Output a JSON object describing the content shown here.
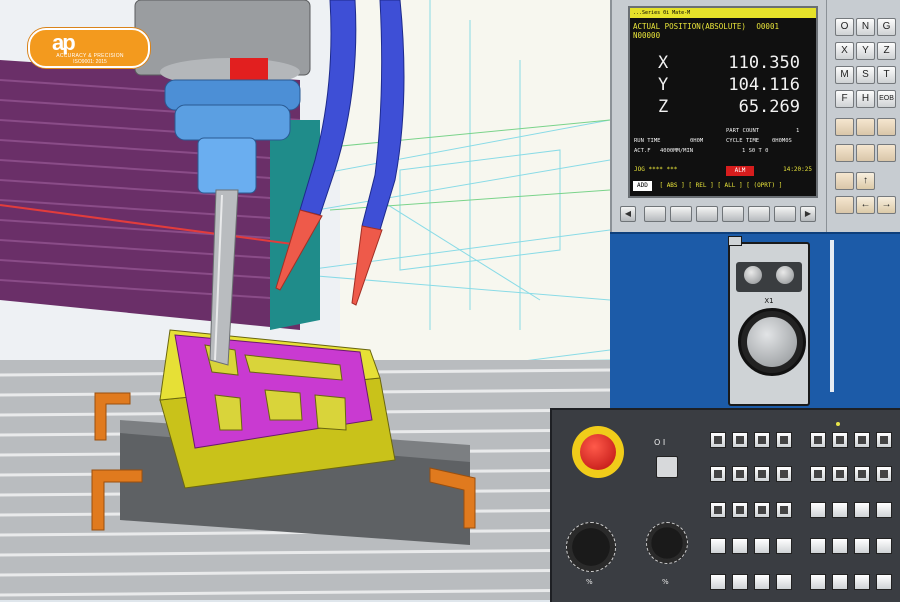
{
  "logo": {
    "mark": "ap",
    "tagline": "ACCURACY & PRECISION",
    "cert": "ISO9001: 2015"
  },
  "program_code": [
    "",
    "",
    "",
    "",
    "",
    "",
    "",
    "",
    "",
    "",
    "",
    "",
    "",
    "",
    "",
    "",
    "",
    "",
    "",
    "",
    "",
    "",
    "",
    "",
    ""
  ],
  "screen": {
    "header": "...Series 0i Mate-M",
    "title": "ACTUAL POSITION(ABSOLUTE)",
    "prog_no": "O0001",
    "seq_no": "N00000",
    "axes": [
      {
        "name": "X",
        "value": "110.350"
      },
      {
        "name": "Y",
        "value": "104.116"
      },
      {
        "name": "Z",
        "value": "65.269"
      }
    ],
    "part_count_label": "PART COUNT",
    "part_count": "1",
    "run_time_label": "RUN TIME",
    "run_time": "0H0M",
    "cycle_time_label": "CYCLE TIME",
    "cycle_time": "0H0M0S",
    "act_f_label": "ACT.F",
    "act_f": "4000MM/MIN",
    "act_s": "1  S0  T  0",
    "mode": "JOG",
    "stars": "****  ***",
    "alarm": "ALM",
    "time": "14:20:25",
    "add_label": "ADD",
    "soft1": "[ ABS ]",
    "soft2": "[ REL ]",
    "soft3": "[ ALL ]",
    "soft4": "[ (OPRT) ]"
  },
  "keypad": [
    "O",
    "N",
    "G",
    "X",
    "Y",
    "Z",
    "M",
    "S",
    "T",
    "F",
    "H",
    "EOB"
  ],
  "pendant": {
    "scale_label": "X1"
  },
  "panel": {
    "keyswitch_label": "O  I",
    "feed_label": "%",
    "spindle_label": "%"
  },
  "colors": {
    "workpiece": "#c93ad1",
    "fixture": "#e07a1e",
    "tool_holder": "#4c8fd6",
    "coolant": "#3e4fd6",
    "panel_blue": "#1c5ba8"
  }
}
